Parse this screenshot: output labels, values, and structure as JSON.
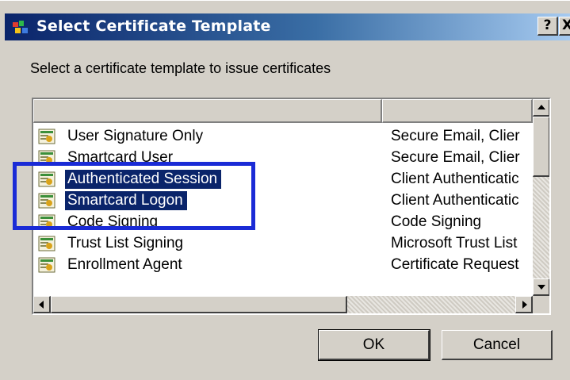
{
  "window": {
    "title": "Select Certificate Template",
    "help_label": "?",
    "close_label": "X"
  },
  "instruction": "Select a certificate template to issue certificates",
  "templates": [
    {
      "name": "User Signature Only",
      "purpose": "Secure Email, Clier",
      "selected": false
    },
    {
      "name": "Smartcard User",
      "purpose": "Secure Email, Clier",
      "selected": false
    },
    {
      "name": "Authenticated Session",
      "purpose": "Client Authenticatic",
      "selected": true
    },
    {
      "name": "Smartcard Logon",
      "purpose": "Client Authenticatic",
      "selected": true
    },
    {
      "name": "Code Signing",
      "purpose": "Code Signing",
      "selected": false
    },
    {
      "name": "Trust List Signing",
      "purpose": "Microsoft Trust List",
      "selected": false
    },
    {
      "name": "Enrollment Agent",
      "purpose": "Certificate Request",
      "selected": false
    }
  ],
  "buttons": {
    "ok": "OK",
    "cancel": "Cancel"
  },
  "colors": {
    "selection": "#0a246a",
    "annotation_box": "#1a2bd6",
    "dialog_face": "#d4d0c8"
  },
  "icons": {
    "title": "certificate-app-icon",
    "row": "certificate-template-icon"
  }
}
